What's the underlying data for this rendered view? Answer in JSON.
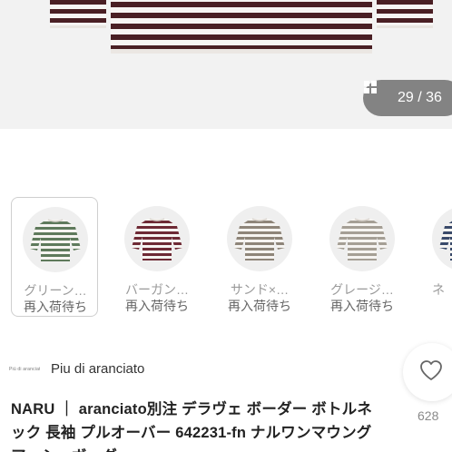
{
  "gallery": {
    "current": "29",
    "total": "36",
    "counter_text": "29 / 36"
  },
  "variants": [
    {
      "name": "グリーン…",
      "status": "再入荷待ち",
      "stripe_color": "#5f7a5c"
    },
    {
      "name": "バーガン…",
      "status": "再入荷待ち",
      "stripe_color": "#6e2a35"
    },
    {
      "name": "サンド×…",
      "status": "再入荷待ち",
      "stripe_color": "#8e8579"
    },
    {
      "name": "グレージ…",
      "status": "再入荷待ち",
      "stripe_color": "#a59f95"
    },
    {
      "name": "ネ",
      "status": "",
      "stripe_color": "#3a4a6a"
    }
  ],
  "shop": {
    "logo_text": "Più di aranciato",
    "name": "Piu di aranciato"
  },
  "favorite": {
    "count": "628"
  },
  "product": {
    "title": "NARU ｜ aranciato別注 デラヴェ ボーダー ボトルネック 長袖 プルオーバー 642231-fn ナルワンマウングアッシュボーダー"
  },
  "colors": {
    "hero_stripe_dark": "#4a1f24",
    "hero_background": "#f2f2f2",
    "counter_background": "#666666"
  }
}
